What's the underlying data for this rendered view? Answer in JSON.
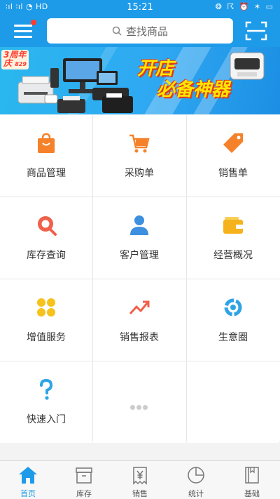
{
  "status_bar": {
    "left_icons": "∶ıl ∶ıl ◔ HD",
    "time": "15:21",
    "right_icons": "❂ ☈ ⏰ ✶ ▭"
  },
  "header": {
    "search_placeholder": "查找商品"
  },
  "banner": {
    "anniversary_num": "3",
    "anniversary_text": "周年",
    "anniversary_line2": "庆",
    "anniversary_date": "829",
    "headline_line1": "开店",
    "headline_line2": "必备神器"
  },
  "grid": {
    "items": [
      {
        "label": "商品管理",
        "icon": "shopping-bag-icon",
        "color": "#f5822a"
      },
      {
        "label": "采购单",
        "icon": "cart-icon",
        "color": "#f5822a"
      },
      {
        "label": "销售单",
        "icon": "tag-icon",
        "color": "#f5822a"
      },
      {
        "label": "库存查询",
        "icon": "inventory-search-icon",
        "color": "#f0604a"
      },
      {
        "label": "客户管理",
        "icon": "person-icon",
        "color": "#3d8fe0"
      },
      {
        "label": "经营概况",
        "icon": "wallet-icon",
        "color": "#f5b21d"
      },
      {
        "label": "增值服务",
        "icon": "clover-icon",
        "color": "#f6c21c"
      },
      {
        "label": "销售报表",
        "icon": "trend-icon",
        "color": "#f0604a"
      },
      {
        "label": "生意圈",
        "icon": "circle-arrows-icon",
        "color": "#2ea4e4"
      },
      {
        "label": "快速入门",
        "icon": "question-icon",
        "color": "#2ea4e4"
      }
    ]
  },
  "tabbar": {
    "tabs": [
      {
        "label": "首页",
        "icon": "home-icon",
        "active": true
      },
      {
        "label": "库存",
        "icon": "box-icon",
        "active": false
      },
      {
        "label": "销售",
        "icon": "yen-receipt-icon",
        "active": false
      },
      {
        "label": "统计",
        "icon": "pie-chart-icon",
        "active": false
      },
      {
        "label": "基础",
        "icon": "book-icon",
        "active": false
      }
    ]
  },
  "colors": {
    "brand": "#1e9be8",
    "accent_orange": "#f5822a"
  }
}
